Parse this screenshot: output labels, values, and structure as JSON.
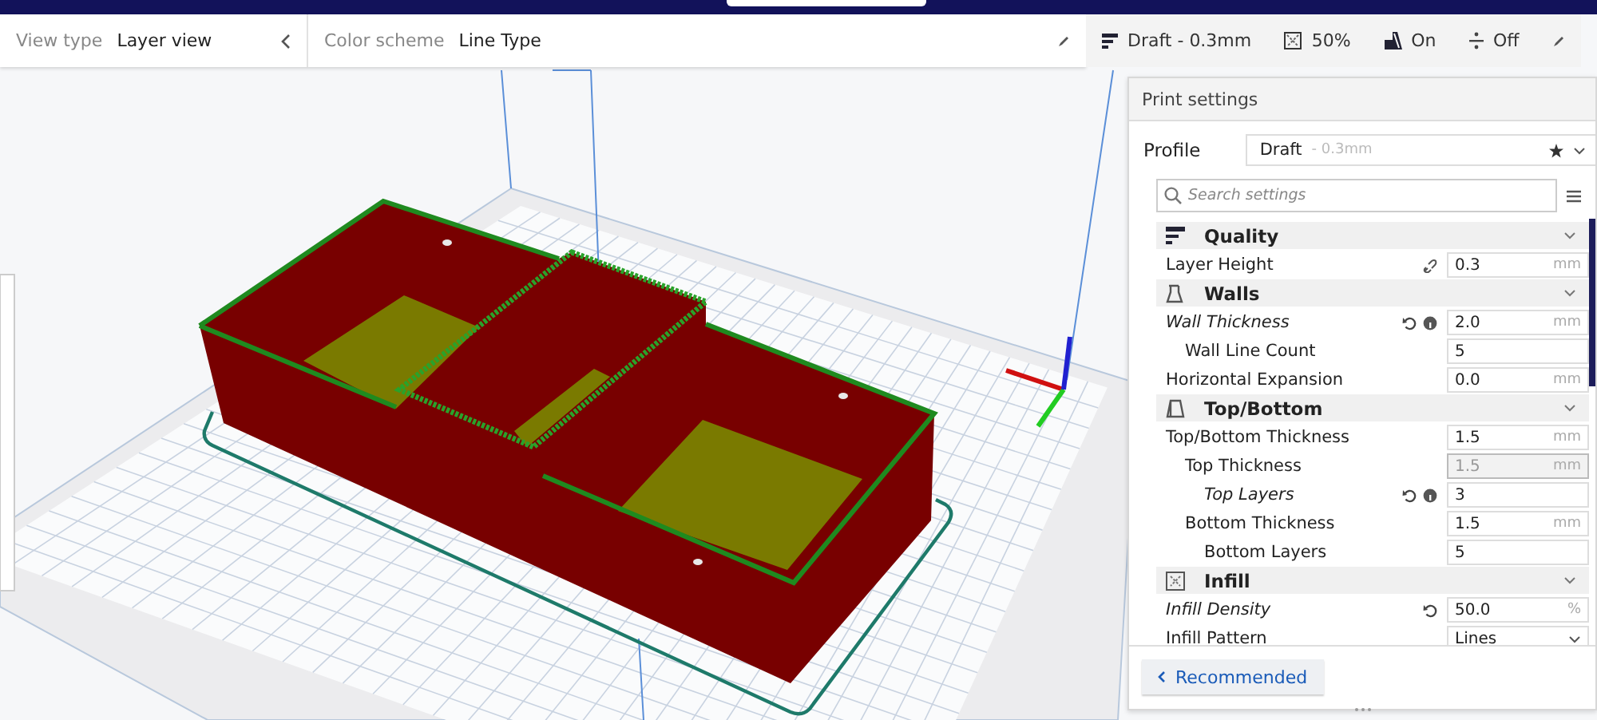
{
  "view_bar": {
    "view_type_label": "View type",
    "view_type": "Layer view",
    "color_scheme_label": "Color scheme",
    "color_scheme": "Line Type"
  },
  "print_setup_bar": {
    "profile": "Draft - 0.3mm",
    "infill": "50%",
    "support": "On",
    "adhesion": "Off"
  },
  "print_settings": {
    "title": "Print settings",
    "profile_label": "Profile",
    "profile_name": "Draft",
    "profile_detail": "- 0.3mm",
    "search_placeholder": "Search settings",
    "sections": [
      {
        "kind": "quality",
        "title": "Quality",
        "expanded": true,
        "settings": [
          {
            "kind": "number",
            "label": "Layer Height",
            "value": "0.3",
            "unit": "mm",
            "modified": false,
            "linked": true,
            "resettable": false,
            "info": false,
            "enabled": true
          }
        ]
      },
      {
        "kind": "walls",
        "title": "Walls",
        "expanded": true,
        "settings": [
          {
            "kind": "number",
            "label": "Wall Thickness",
            "value": "2.0",
            "unit": "mm",
            "modified": true,
            "linked": false,
            "resettable": true,
            "info": true,
            "enabled": true,
            "children": [
              {
                "kind": "number",
                "label": "Wall Line Count",
                "value": "5",
                "modified": false,
                "linked": false,
                "resettable": false,
                "info": false,
                "enabled": true
              }
            ]
          },
          {
            "kind": "number",
            "label": "Horizontal Expansion",
            "value": "0.0",
            "unit": "mm",
            "modified": false,
            "linked": false,
            "resettable": false,
            "info": false,
            "enabled": true
          }
        ]
      },
      {
        "kind": "topbottom",
        "title": "Top/Bottom",
        "expanded": true,
        "settings": [
          {
            "kind": "number",
            "label": "Top/Bottom Thickness",
            "value": "1.5",
            "unit": "mm",
            "modified": false,
            "linked": false,
            "resettable": false,
            "info": false,
            "enabled": true,
            "children": [
              {
                "kind": "number",
                "label": "Top Thickness",
                "value": "1.5",
                "unit": "mm",
                "modified": false,
                "linked": false,
                "resettable": false,
                "info": false,
                "enabled": false,
                "children": [
                  {
                    "kind": "number",
                    "label": "Top Layers",
                    "value": "3",
                    "modified": true,
                    "linked": false,
                    "resettable": true,
                    "info": true,
                    "enabled": true
                  }
                ]
              },
              {
                "kind": "number",
                "label": "Bottom Thickness",
                "value": "1.5",
                "unit": "mm",
                "modified": false,
                "linked": false,
                "resettable": false,
                "info": false,
                "enabled": true,
                "children": [
                  {
                    "kind": "number",
                    "label": "Bottom Layers",
                    "value": "5",
                    "modified": false,
                    "linked": false,
                    "resettable": false,
                    "info": false,
                    "enabled": true
                  }
                ]
              }
            ]
          }
        ]
      },
      {
        "kind": "infill",
        "title": "Infill",
        "expanded": true,
        "settings": [
          {
            "kind": "number",
            "label": "Infill Density",
            "value": "50.0",
            "unit": "%",
            "modified": true,
            "linked": false,
            "resettable": true,
            "info": false,
            "enabled": true
          },
          {
            "kind": "dropdown",
            "label": "Infill Pattern",
            "value": "Lines",
            "modified": false,
            "linked": false,
            "resettable": false,
            "info": false,
            "enabled": true
          }
        ]
      }
    ],
    "recommended_button": "Recommended"
  }
}
